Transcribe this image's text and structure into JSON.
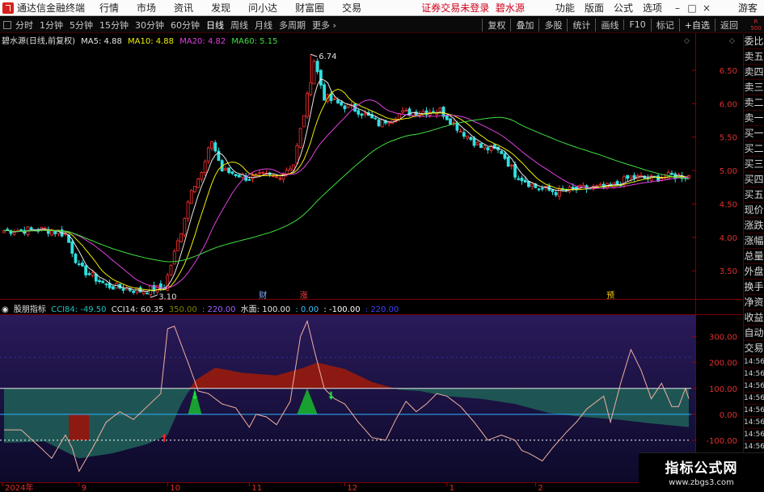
{
  "app": {
    "title": "通达信金融终端",
    "menus": [
      "行情",
      "市场",
      "资讯",
      "发现",
      "问小达",
      "财富圈",
      "交易"
    ],
    "warning": "证券交易未登录",
    "warning_stock": "碧水源",
    "right_menus": [
      "功能",
      "版面",
      "公式",
      "选项"
    ],
    "guest": "游客"
  },
  "tabs": [
    "分时",
    "1分钟",
    "5分钟",
    "15分钟",
    "30分钟",
    "60分钟",
    "日线",
    "周线",
    "月线",
    "多周期",
    "更多"
  ],
  "active_tab": "日线",
  "tools": [
    "复权",
    "叠加",
    "多股",
    "统计",
    "画线",
    "F10",
    "标记",
    "+自选",
    "返回"
  ],
  "corner_tag": [
    "R",
    "500"
  ],
  "legend": {
    "stock": "碧水源(日线,前复权)",
    "ma5": "MA5: 4.88",
    "ma10": "MA10: 4.88",
    "ma20": "MA20: 4.82",
    "ma60": "MA60: 5.15"
  },
  "indicator_legend": {
    "name": "股朋指标",
    "items": [
      {
        "text": "CCI84: -49.50",
        "color": "#20c0c0"
      },
      {
        "text": "CCI14: 60.35",
        "color": "#e8e8e8"
      },
      {
        "text": "350.00",
        "color": "#808000"
      },
      {
        "text": ": 220.00",
        "color": "#a060ff"
      },
      {
        "text": "水面: 100.00",
        "color": "#e8e8e8"
      },
      {
        "text": ": 0.00",
        "color": "#40c0ff"
      },
      {
        "text": ": -100.00",
        "color": "#ffffff"
      },
      {
        "text": ": 220.00",
        "color": "#4040ff"
      }
    ]
  },
  "side_panel": [
    "委比",
    "卖五",
    "卖四",
    "卖三",
    "卖二",
    "卖一",
    "买一",
    "买二",
    "买三",
    "买四",
    "买五",
    "现价",
    "涨跌",
    "涨幅",
    "总量",
    "外盘",
    "换手",
    "净资",
    "收益",
    "自动",
    "交易"
  ],
  "side_times": [
    "14:56",
    "14:56",
    "14:56",
    "14:56",
    "14:56",
    "14:56",
    "14:56",
    "14:56",
    "14:56"
  ],
  "watermark": {
    "line1": "指标公式网",
    "line2": "www.zbgs3.com"
  },
  "chart_data": [
    {
      "type": "candlestick",
      "title": "碧水源(日线,前复权)",
      "ylim": [
        3.2,
        6.85
      ],
      "yticks": [
        3.5,
        4.0,
        4.5,
        5.0,
        5.5,
        6.0,
        6.5
      ],
      "x_ticks": [
        "2024年",
        "9",
        "10",
        "11",
        "12",
        "1",
        "2"
      ],
      "annotations": [
        {
          "text": "6.74",
          "index": 90,
          "price": 6.74
        },
        {
          "text": "3.10",
          "index": 43,
          "price": 3.1
        }
      ],
      "event_markers": [
        {
          "text": "财",
          "index": 76,
          "color": "#80b0ff"
        },
        {
          "text": "涨",
          "index": 88,
          "color": "#ff4040"
        },
        {
          "text": "预",
          "index": 178,
          "color": "#ffcc00"
        }
      ],
      "ma_series": [
        {
          "name": "MA5",
          "color": "#e8e8e8"
        },
        {
          "name": "MA10",
          "color": "#f0f000"
        },
        {
          "name": "MA20",
          "color": "#e040e0"
        },
        {
          "name": "MA60",
          "color": "#40e040"
        }
      ],
      "anchors": [
        [
          0,
          4.1
        ],
        [
          12,
          4.12
        ],
        [
          18,
          4.05
        ],
        [
          22,
          3.55
        ],
        [
          30,
          3.28
        ],
        [
          40,
          3.2
        ],
        [
          47,
          3.25
        ],
        [
          52,
          4.1
        ],
        [
          55,
          4.75
        ],
        [
          58,
          4.95
        ],
        [
          61,
          5.45
        ],
        [
          64,
          5.0
        ],
        [
          68,
          4.95
        ],
        [
          72,
          4.88
        ],
        [
          76,
          4.92
        ],
        [
          80,
          4.9
        ],
        [
          85,
          5.1
        ],
        [
          89,
          6.1
        ],
        [
          91,
          6.65
        ],
        [
          94,
          6.1
        ],
        [
          98,
          6.0
        ],
        [
          104,
          5.9
        ],
        [
          110,
          5.7
        ],
        [
          116,
          5.85
        ],
        [
          122,
          5.88
        ],
        [
          128,
          5.9
        ],
        [
          134,
          5.6
        ],
        [
          140,
          5.35
        ],
        [
          146,
          5.28
        ],
        [
          150,
          4.95
        ],
        [
          156,
          4.75
        ],
        [
          162,
          4.68
        ],
        [
          170,
          4.73
        ],
        [
          178,
          4.75
        ],
        [
          184,
          4.9
        ],
        [
          190,
          4.88
        ],
        [
          196,
          4.92
        ],
        [
          201,
          4.92
        ]
      ]
    },
    {
      "type": "line",
      "title": "股朋指标",
      "ylim": [
        -250,
        380
      ],
      "yticks": [
        300,
        200,
        100,
        0,
        -100
      ],
      "series": [
        {
          "name": "CCI84",
          "color": "#20c0c0"
        },
        {
          "name": "CCI14",
          "color": "#f0b0a0"
        }
      ],
      "cci84_anchors": [
        [
          0,
          -110
        ],
        [
          12,
          -105
        ],
        [
          22,
          -170
        ],
        [
          32,
          -150
        ],
        [
          42,
          -115
        ],
        [
          48,
          -80
        ],
        [
          52,
          40
        ],
        [
          56,
          130
        ],
        [
          62,
          180
        ],
        [
          70,
          160
        ],
        [
          80,
          150
        ],
        [
          88,
          180
        ],
        [
          92,
          200
        ],
        [
          100,
          175
        ],
        [
          108,
          125
        ],
        [
          116,
          95
        ],
        [
          122,
          90
        ],
        [
          130,
          70
        ],
        [
          140,
          60
        ],
        [
          150,
          40
        ],
        [
          160,
          5
        ],
        [
          170,
          -10
        ],
        [
          180,
          -20
        ],
        [
          190,
          -35
        ],
        [
          201,
          -49.5
        ]
      ],
      "cci14_anchors": [
        [
          0,
          -60
        ],
        [
          5,
          -60
        ],
        [
          10,
          -120
        ],
        [
          14,
          -170
        ],
        [
          18,
          -80
        ],
        [
          20,
          -130
        ],
        [
          22,
          -220
        ],
        [
          26,
          -130
        ],
        [
          30,
          -30
        ],
        [
          34,
          10
        ],
        [
          38,
          -20
        ],
        [
          42,
          30
        ],
        [
          46,
          80
        ],
        [
          48,
          330
        ],
        [
          50,
          340
        ],
        [
          52,
          270
        ],
        [
          54,
          200
        ],
        [
          57,
          90
        ],
        [
          60,
          80
        ],
        [
          64,
          40
        ],
        [
          68,
          25
        ],
        [
          72,
          -50
        ],
        [
          74,
          0
        ],
        [
          77,
          -10
        ],
        [
          80,
          -40
        ],
        [
          84,
          50
        ],
        [
          87,
          300
        ],
        [
          89,
          360
        ],
        [
          91,
          250
        ],
        [
          94,
          100
        ],
        [
          97,
          60
        ],
        [
          100,
          40
        ],
        [
          104,
          -30
        ],
        [
          108,
          -90
        ],
        [
          112,
          -100
        ],
        [
          115,
          -20
        ],
        [
          118,
          50
        ],
        [
          121,
          10
        ],
        [
          124,
          40
        ],
        [
          127,
          80
        ],
        [
          130,
          70
        ],
        [
          134,
          30
        ],
        [
          138,
          -30
        ],
        [
          142,
          -100
        ],
        [
          146,
          -80
        ],
        [
          150,
          -100
        ],
        [
          152,
          -140
        ],
        [
          154,
          -150
        ],
        [
          158,
          -180
        ],
        [
          161,
          -130
        ],
        [
          165,
          -70
        ],
        [
          168,
          -30
        ],
        [
          171,
          20
        ],
        [
          174,
          50
        ],
        [
          176,
          70
        ],
        [
          178,
          -30
        ],
        [
          181,
          120
        ],
        [
          184,
          250
        ],
        [
          187,
          170
        ],
        [
          190,
          60
        ],
        [
          193,
          120
        ],
        [
          196,
          30
        ],
        [
          198,
          30
        ],
        [
          200,
          100
        ],
        [
          201,
          60.35
        ]
      ],
      "up_arrows": [
        47
      ],
      "down_arrows": [
        56,
        96
      ]
    }
  ]
}
